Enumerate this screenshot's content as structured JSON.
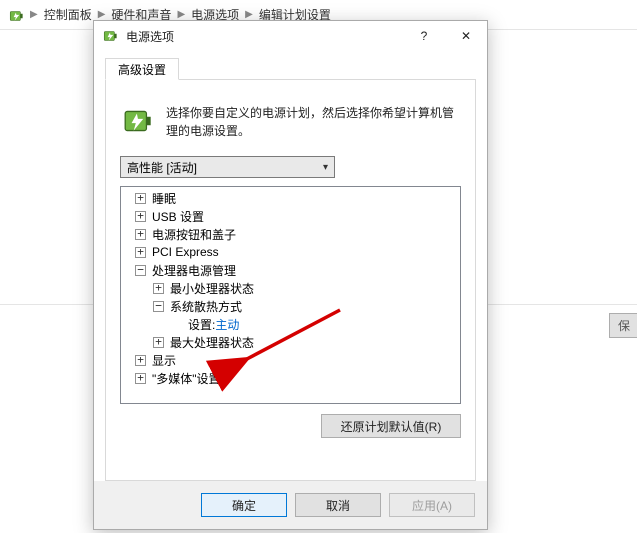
{
  "breadcrumb": {
    "items": [
      "控制面板",
      "硬件和声音",
      "电源选项",
      "编辑计划设置"
    ]
  },
  "bg": {
    "save_partial": "保"
  },
  "dialog": {
    "title": "电源选项",
    "help_symbol": "?",
    "close_symbol": "✕",
    "tab_label": "高级设置",
    "description": "选择你要自定义的电源计划，然后选择你希望计算机管理的电源设置。",
    "plan_selected": "高性能 [活动]",
    "restore_button": "还原计划默认值(R)",
    "buttons": {
      "ok": "确定",
      "cancel": "取消",
      "apply": "应用(A)"
    }
  },
  "tree": {
    "nodes": [
      {
        "expanded": false,
        "level": 1,
        "label": "睡眠"
      },
      {
        "expanded": false,
        "level": 1,
        "label": "USB 设置"
      },
      {
        "expanded": false,
        "level": 1,
        "label": "电源按钮和盖子"
      },
      {
        "expanded": false,
        "level": 1,
        "label": "PCI Express"
      },
      {
        "expanded": true,
        "level": 1,
        "label": "处理器电源管理"
      },
      {
        "expanded": false,
        "level": 2,
        "label": "最小处理器状态"
      },
      {
        "expanded": true,
        "level": 2,
        "label": "系统散热方式"
      },
      {
        "expanded": null,
        "level": 3,
        "label": "设置:",
        "value": "主动"
      },
      {
        "expanded": false,
        "level": 2,
        "label": "最大处理器状态"
      },
      {
        "expanded": false,
        "level": 1,
        "label": "显示"
      },
      {
        "expanded": false,
        "level": 1,
        "label": "\"多媒体\"设置"
      }
    ]
  }
}
